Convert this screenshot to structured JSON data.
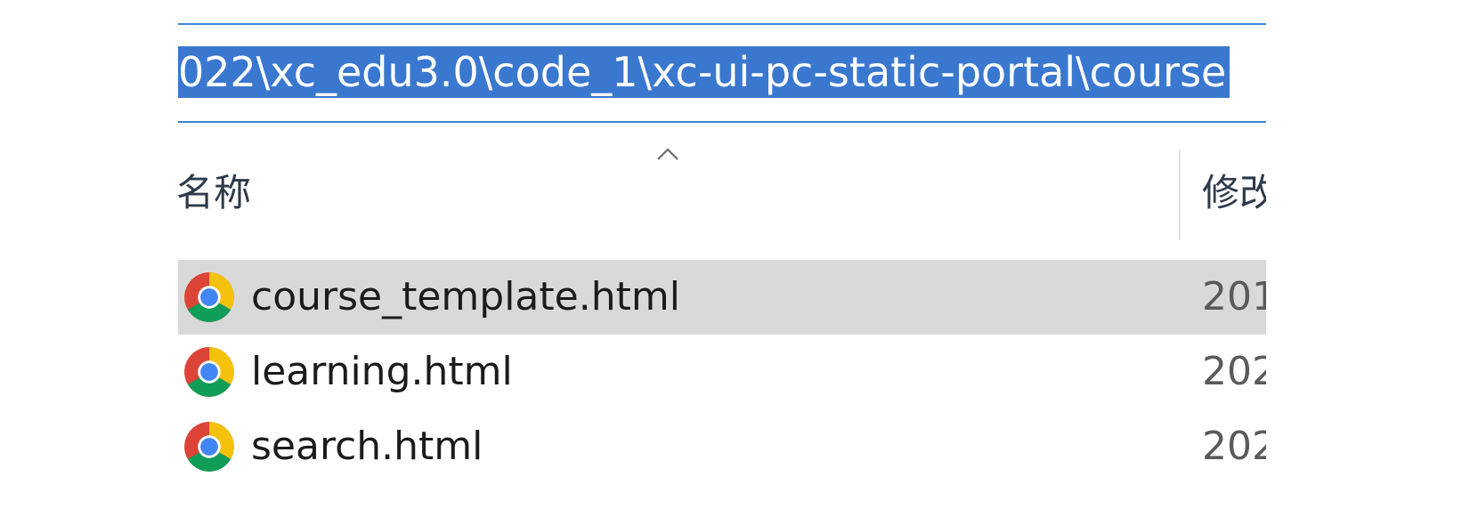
{
  "address_bar": {
    "path": "022\\xc_edu3.0\\code_1\\xc-ui-pc-static-portal\\course"
  },
  "columns": {
    "name_label": "名称",
    "modified_label": "修改",
    "sort_icon": "chevron-up-icon"
  },
  "files": [
    {
      "name": "course_template.html",
      "modified": "201",
      "icon": "chrome-icon",
      "selected": true
    },
    {
      "name": "learning.html",
      "modified": "202",
      "icon": "chrome-icon",
      "selected": false
    },
    {
      "name": "search.html",
      "modified": "202",
      "icon": "chrome-icon",
      "selected": false
    }
  ],
  "colors": {
    "selection_highlight": "#3a78d0",
    "bar_border": "#3d85d6",
    "row_selected": "#d9d9d9"
  }
}
